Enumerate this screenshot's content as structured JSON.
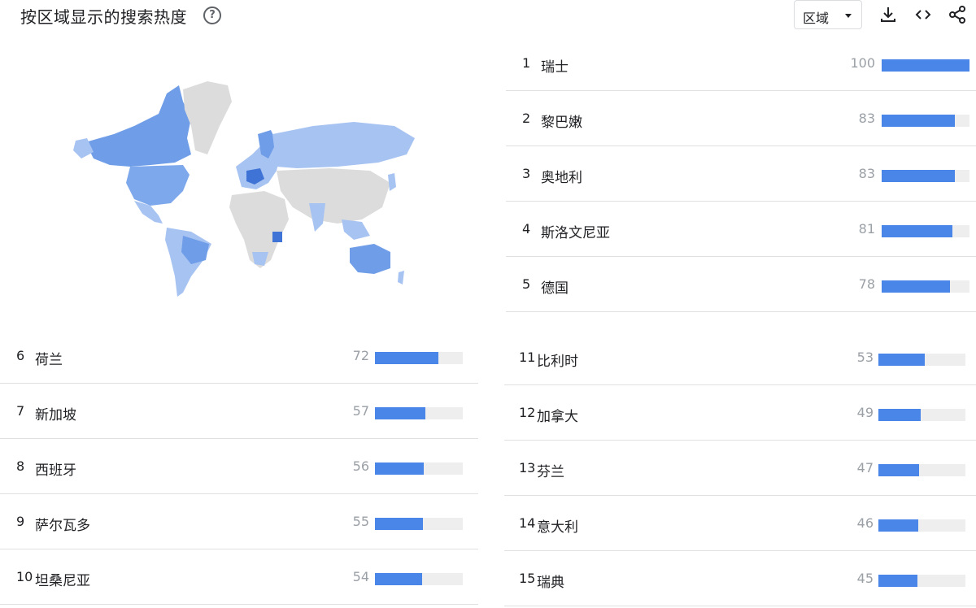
{
  "header": {
    "title": "按区域显示的搜索热度",
    "help_icon": "question-circle-icon",
    "region_select": {
      "selected": "区域"
    },
    "tools": [
      "download-icon",
      "embed-code-icon",
      "share-icon"
    ]
  },
  "colors": {
    "bar": "#4a86e8",
    "track": "#eeeeee",
    "map_none": "#dcdcdc",
    "map_low": "#a7c3f2",
    "map_mid": "#6f9de8",
    "map_high": "#3f74d6"
  },
  "list_top": [
    {
      "rank": "1",
      "name": "瑞士",
      "value": "100",
      "fill": 1.0
    },
    {
      "rank": "2",
      "name": "黎巴嫩",
      "value": "83",
      "fill": 0.83
    },
    {
      "rank": "3",
      "name": "奥地利",
      "value": "83",
      "fill": 0.83
    },
    {
      "rank": "4",
      "name": "斯洛文尼亚",
      "value": "81",
      "fill": 0.81
    },
    {
      "rank": "5",
      "name": "德国",
      "value": "78",
      "fill": 0.78
    }
  ],
  "list_left": [
    {
      "rank": "6",
      "name": "荷兰",
      "value": "72",
      "fill": 0.72
    },
    {
      "rank": "7",
      "name": "新加坡",
      "value": "57",
      "fill": 0.57
    },
    {
      "rank": "8",
      "name": "西班牙",
      "value": "56",
      "fill": 0.56
    },
    {
      "rank": "9",
      "name": "萨尔瓦多",
      "value": "55",
      "fill": 0.55
    },
    {
      "rank": "10",
      "name": "坦桑尼亚",
      "value": "54",
      "fill": 0.54
    }
  ],
  "list_right": [
    {
      "rank": "11",
      "name": "比利时",
      "value": "53",
      "fill": 0.53
    },
    {
      "rank": "12",
      "name": "加拿大",
      "value": "49",
      "fill": 0.49
    },
    {
      "rank": "13",
      "name": "芬兰",
      "value": "47",
      "fill": 0.47
    },
    {
      "rank": "14",
      "name": "意大利",
      "value": "46",
      "fill": 0.46
    },
    {
      "rank": "15",
      "name": "瑞典",
      "value": "45",
      "fill": 0.45
    }
  ]
}
